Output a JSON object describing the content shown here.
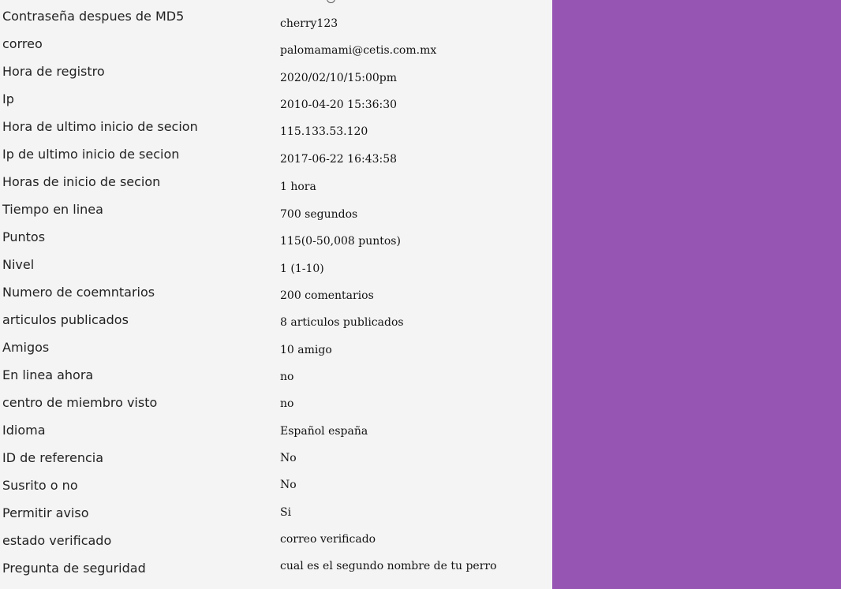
{
  "colors": {
    "left_background": "#f4f4f4",
    "right_panel": "#9654b3",
    "text": "#222222"
  },
  "profile": {
    "rows": [
      {
        "label": "Contraseña despues de MD5",
        "value": "cherry123"
      },
      {
        "label": "correo",
        "value": "palomamami@cetis.com.mx"
      },
      {
        "label": "Hora de registro",
        "value": "2020/02/10/15:00pm"
      },
      {
        "label": "Ip",
        "value": "2010-04-20 15:36:30"
      },
      {
        "label": "Hora de ultimo inicio de secion",
        "value": "115.133.53.120"
      },
      {
        "label": "Ip de ultimo inicio de secion",
        "value": "2017-06-22 16:43:58"
      },
      {
        "label": "Horas de inicio de secion",
        "value": "1 hora"
      },
      {
        "label": "Tiempo en linea",
        "value": "700 segundos"
      },
      {
        "label": "Puntos",
        "value": "115(0-50,008 puntos)"
      },
      {
        "label": "Nivel",
        "value": "1 (1-10)"
      },
      {
        "label": "Numero de coemntarios",
        "value": "200 comentarios"
      },
      {
        "label": "articulos publicados",
        "value": "8 articulos publicados"
      },
      {
        "label": "Amigos",
        "value": "10 amigo"
      },
      {
        "label": "En linea ahora",
        "value": "no"
      },
      {
        "label": "centro de miembro visto",
        "value": "no"
      },
      {
        "label": "Idioma",
        "value": "Español españa"
      },
      {
        "label": "ID de referencia",
        "value": "No"
      },
      {
        "label": "Susrito o no",
        "value": "No"
      },
      {
        "label": "Permitir aviso",
        "value": "Si"
      },
      {
        "label": "estado verificado",
        "value": "correo verificado"
      },
      {
        "label": "Pregunta de seguridad",
        "value": "cual es el segundo nombre de tu perro"
      }
    ]
  }
}
